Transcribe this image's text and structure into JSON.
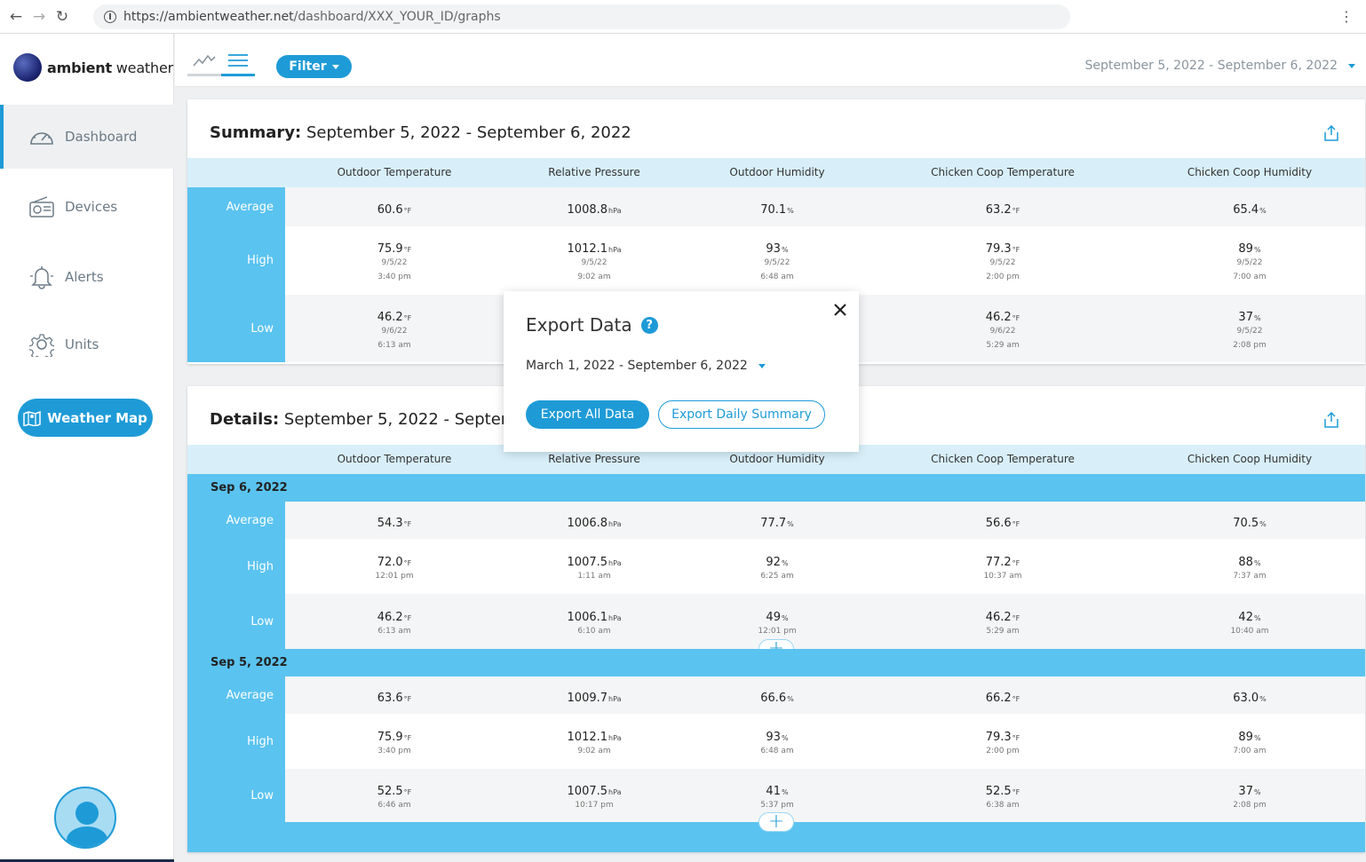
{
  "browser": {
    "url_domain": "https://ambientweather.net",
    "url_path": "/dashboard/XXX_YOUR_ID/graphs"
  },
  "logo": {
    "brand_bold": "ambient",
    "brand_light": "weather"
  },
  "sidebar": {
    "items": [
      {
        "label": "Dashboard",
        "icon": "gauge-icon",
        "active": true
      },
      {
        "label": "Devices",
        "icon": "radio-device-icon"
      },
      {
        "label": "Alerts",
        "icon": "bell-icon"
      },
      {
        "label": "Units",
        "icon": "gear-icon"
      }
    ],
    "weather_map_label": "Weather Map"
  },
  "topbar": {
    "filter_label": "Filter",
    "date_range": "September 5, 2022 - September 6, 2022"
  },
  "columns": [
    "Outdoor Temperature",
    "Relative Pressure",
    "Outdoor Humidity",
    "Chicken Coop Temperature",
    "Chicken Coop Humidity"
  ],
  "summary": {
    "title_bold": "Summary:",
    "title_range": "September 5, 2022 - September 6, 2022",
    "rows": [
      {
        "label": "Average",
        "cells": [
          {
            "value": "60.6",
            "unit": "°F"
          },
          {
            "value": "1008.8",
            "unit": "hPa"
          },
          {
            "value": "70.1",
            "unit": "%"
          },
          {
            "value": "63.2",
            "unit": "°F"
          },
          {
            "value": "65.4",
            "unit": "%"
          }
        ]
      },
      {
        "label": "High",
        "cells": [
          {
            "value": "75.9",
            "unit": "°F",
            "date": "9/5/22",
            "time": "3:40 pm"
          },
          {
            "value": "1012.1",
            "unit": "hPa",
            "date": "9/5/22",
            "time": "9:02 am"
          },
          {
            "value": "93",
            "unit": "%",
            "date": "9/5/22",
            "time": "6:48 am"
          },
          {
            "value": "79.3",
            "unit": "°F",
            "date": "9/5/22",
            "time": "2:00 pm"
          },
          {
            "value": "89",
            "unit": "%",
            "date": "9/5/22",
            "time": "7:00 am"
          }
        ]
      },
      {
        "label": "Low",
        "cells": [
          {
            "value": "46.2",
            "unit": "°F",
            "date": "9/6/22",
            "time": "6:13 am"
          },
          null,
          null,
          {
            "value": "46.2",
            "unit": "°F",
            "date": "9/6/22",
            "time": "5:29 am"
          },
          {
            "value": "37",
            "unit": "%",
            "date": "9/5/22",
            "time": "2:08 pm"
          }
        ]
      }
    ]
  },
  "details": {
    "title_bold": "Details:",
    "title_range": "September 5, 2022 - September",
    "days": [
      {
        "date": "Sep 6, 2022",
        "rows": [
          {
            "label": "Average",
            "cells": [
              {
                "value": "54.3",
                "unit": "°F"
              },
              {
                "value": "1006.8",
                "unit": "hPa"
              },
              {
                "value": "77.7",
                "unit": "%"
              },
              {
                "value": "56.6",
                "unit": "°F"
              },
              {
                "value": "70.5",
                "unit": "%"
              }
            ]
          },
          {
            "label": "High",
            "cells": [
              {
                "value": "72.0",
                "unit": "°F",
                "time": "12:01 pm"
              },
              {
                "value": "1007.5",
                "unit": "hPa",
                "time": "1:11 am"
              },
              {
                "value": "92",
                "unit": "%",
                "time": "6:25 am"
              },
              {
                "value": "77.2",
                "unit": "°F",
                "time": "10:37 am"
              },
              {
                "value": "88",
                "unit": "%",
                "time": "7:37 am"
              }
            ]
          },
          {
            "label": "Low",
            "cells": [
              {
                "value": "46.2",
                "unit": "°F",
                "time": "6:13 am"
              },
              {
                "value": "1006.1",
                "unit": "hPa",
                "time": "6:10 am"
              },
              {
                "value": "49",
                "unit": "%",
                "time": "12:01 pm"
              },
              {
                "value": "46.2",
                "unit": "°F",
                "time": "5:29 am"
              },
              {
                "value": "42",
                "unit": "%",
                "time": "10:40 am"
              }
            ]
          }
        ]
      },
      {
        "date": "Sep 5, 2022",
        "rows": [
          {
            "label": "Average",
            "cells": [
              {
                "value": "63.6",
                "unit": "°F"
              },
              {
                "value": "1009.7",
                "unit": "hPa"
              },
              {
                "value": "66.6",
                "unit": "%"
              },
              {
                "value": "66.2",
                "unit": "°F"
              },
              {
                "value": "63.0",
                "unit": "%"
              }
            ]
          },
          {
            "label": "High",
            "cells": [
              {
                "value": "75.9",
                "unit": "°F",
                "time": "3:40 pm"
              },
              {
                "value": "1012.1",
                "unit": "hPa",
                "time": "9:02 am"
              },
              {
                "value": "93",
                "unit": "%",
                "time": "6:48 am"
              },
              {
                "value": "79.3",
                "unit": "°F",
                "time": "2:00 pm"
              },
              {
                "value": "89",
                "unit": "%",
                "time": "7:00 am"
              }
            ]
          },
          {
            "label": "Low",
            "cells": [
              {
                "value": "52.5",
                "unit": "°F",
                "time": "6:46 am"
              },
              {
                "value": "1007.5",
                "unit": "hPa",
                "time": "10:17 pm"
              },
              {
                "value": "41",
                "unit": "%",
                "time": "5:37 pm"
              },
              {
                "value": "52.5",
                "unit": "°F",
                "time": "6:38 am"
              },
              {
                "value": "37",
                "unit": "%",
                "time": "2:08 pm"
              }
            ]
          }
        ]
      }
    ]
  },
  "modal": {
    "title": "Export Data",
    "help": "?",
    "date_range": "March 1, 2022 - September 6, 2022",
    "export_all_label": "Export All Data",
    "export_daily_label": "Export Daily Summary"
  },
  "colors": {
    "accent": "#1e9bd7",
    "label_column": "#5ac3f0",
    "header_row": "#d8eff9"
  }
}
